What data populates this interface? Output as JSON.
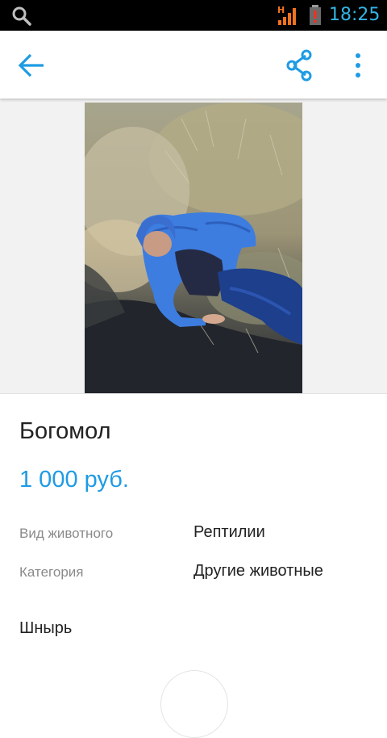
{
  "status_bar": {
    "time": "18:25",
    "network_type": "H",
    "icons": [
      "search-icon",
      "signal-icon",
      "battery-alert-icon"
    ],
    "accent_color": "#33b5e5"
  },
  "app_bar": {
    "icons": [
      "back-arrow-icon",
      "share-icon",
      "more-vert-icon"
    ],
    "icon_color": "#1e9be4"
  },
  "listing": {
    "title": "Богомол",
    "price": "1 000 руб.",
    "price_color": "#1e9be4",
    "params": [
      {
        "label": "Вид животного",
        "value": "Рептилии"
      },
      {
        "label": "Категория",
        "value": "Другие животные"
      }
    ],
    "description": "Шнырь"
  }
}
